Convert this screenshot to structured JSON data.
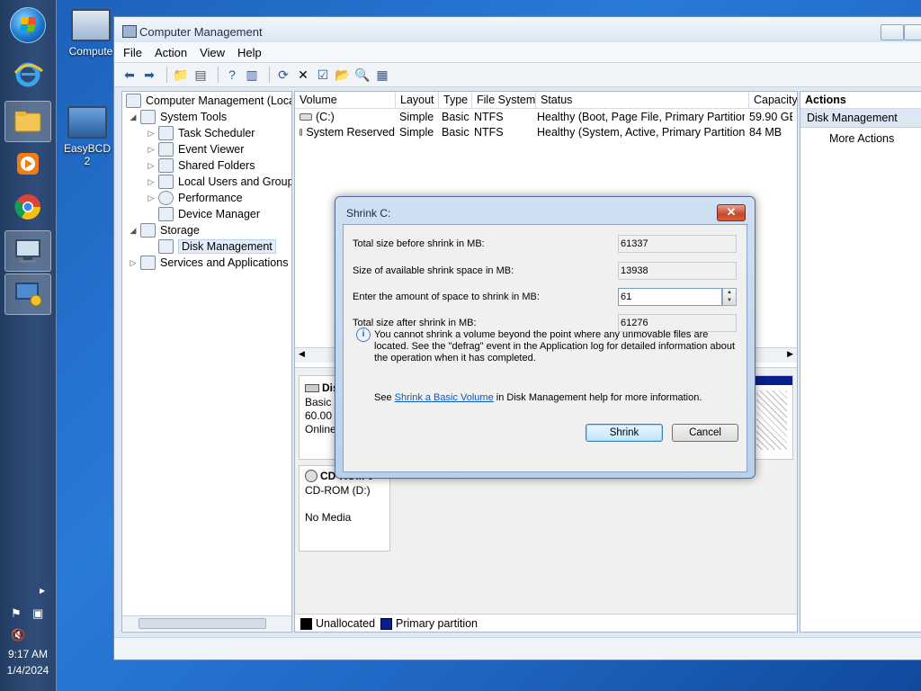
{
  "desktop": {
    "icons": [
      {
        "label": "Compute",
        "icon": "computer-icon"
      },
      {
        "label": "EasyBCD 2",
        "icon": "easybcd-icon"
      }
    ]
  },
  "taskbar": {
    "clock_time": "9:17 AM",
    "clock_date": "1/4/2024",
    "items": [
      "start-orb",
      "internet-explorer-icon",
      "file-explorer-icon",
      "media-player-icon",
      "chrome-icon",
      "computer-management-icon",
      "easybcd-icon"
    ]
  },
  "window": {
    "title": "Computer Management",
    "menu": [
      "File",
      "Action",
      "View",
      "Help"
    ]
  },
  "tree": {
    "root": "Computer Management (Local",
    "system_tools": "System Tools",
    "task_scheduler": "Task Scheduler",
    "event_viewer": "Event Viewer",
    "shared_folders": "Shared Folders",
    "local_users": "Local Users and Groups",
    "performance": "Performance",
    "device_manager": "Device Manager",
    "storage": "Storage",
    "disk_management": "Disk Management",
    "services": "Services and Applications"
  },
  "volumes": {
    "headers": [
      "Volume",
      "Layout",
      "Type",
      "File System",
      "Status",
      "Capacity"
    ],
    "rows": [
      [
        "(C:)",
        "Simple",
        "Basic",
        "NTFS",
        "Healthy (Boot, Page File, Primary Partition)",
        "59.90 GE"
      ],
      [
        "System Reserved",
        "Simple",
        "Basic",
        "NTFS",
        "Healthy (System, Active, Primary Partition)",
        "84 MB"
      ]
    ]
  },
  "disks": {
    "disk0_name": "Dis",
    "disk0_type": "Basic",
    "disk0_size": "60.00 G",
    "disk0_state": "Online",
    "cdrom_name": "CD-ROM 0",
    "cdrom_letter": "CD-ROM (D:)",
    "cdrom_media": "No Media"
  },
  "legend": {
    "unallocated": "Unallocated",
    "primary": "Primary partition",
    "unallocated_color": "#000000",
    "primary_color": "#0a1e8c"
  },
  "actions": {
    "header": "Actions",
    "section": "Disk Management",
    "more": "More Actions"
  },
  "dialog": {
    "title": "Shrink C:",
    "total_before_label": "Total size before shrink in MB:",
    "total_before_value": "61337",
    "available_label": "Size of available shrink space in MB:",
    "available_value": "13938",
    "amount_label": "Enter the amount of space to shrink in MB:",
    "amount_value": "61",
    "total_after_label": "Total size after shrink in MB:",
    "total_after_value": "61276",
    "info_text": "You cannot shrink a volume beyond the point where any unmovable files are located. See the \"defrag\" event in the Application log for detailed information about the operation when it has completed.",
    "help_prefix": "See ",
    "help_link": "Shrink a Basic Volume",
    "help_suffix": " in Disk Management help for more information.",
    "shrink_button": "Shrink",
    "cancel_button": "Cancel"
  }
}
